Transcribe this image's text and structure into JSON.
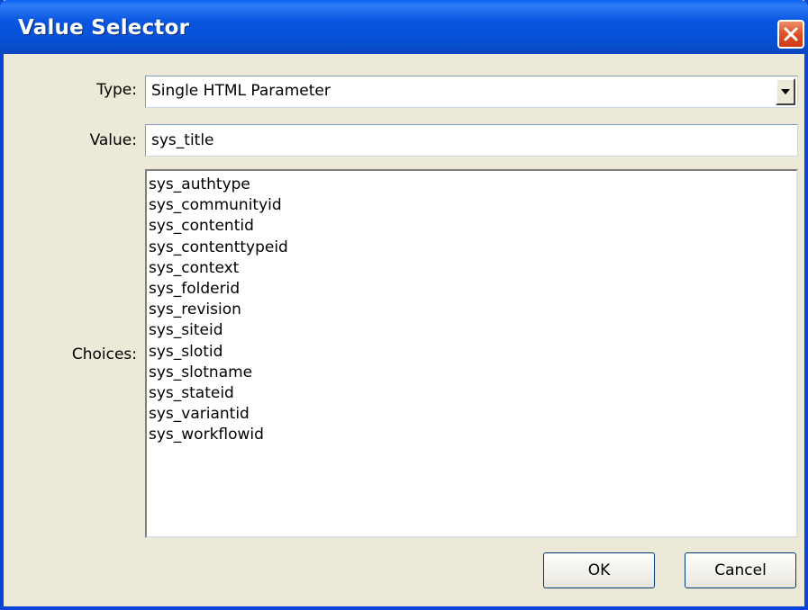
{
  "window": {
    "title": "Value Selector",
    "close_icon": "close-icon"
  },
  "form": {
    "type_label": "Type:",
    "type_value": "Single HTML Parameter",
    "value_label": "Value:",
    "value_text": "sys_title",
    "choices_label": "Choices:",
    "choices": [
      "sys_authtype",
      "sys_communityid",
      "sys_contentid",
      "sys_contenttypeid",
      "sys_context",
      "sys_folderid",
      "sys_revision",
      "sys_siteid",
      "sys_slotid",
      "sys_slotname",
      "sys_stateid",
      "sys_variantid",
      "sys_workflowid"
    ]
  },
  "buttons": {
    "ok_label": "OK",
    "cancel_label": "Cancel"
  },
  "colors": {
    "titlebar": "#0855e0",
    "close_button": "#e2542a",
    "dialog_bg": "#ece9d8"
  }
}
